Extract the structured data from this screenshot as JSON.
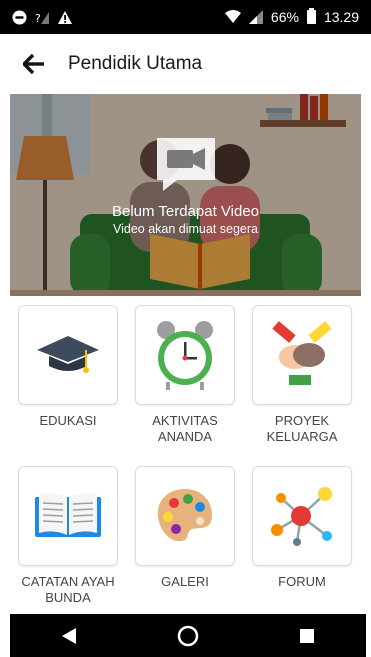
{
  "status_bar": {
    "battery": "66%",
    "time": "13.29",
    "icons": [
      "minus-circle-icon",
      "no-sim-icon",
      "warning-icon",
      "wifi-icon",
      "signal-icon",
      "battery-icon"
    ]
  },
  "header": {
    "back_icon": "arrow-back-icon",
    "title": "Pendidik Utama"
  },
  "hero": {
    "video_title": "Belum Terdapat Video",
    "video_subtitle": "Video akan dimuat segera",
    "icon": "video-camera-icon"
  },
  "menu": {
    "items": [
      {
        "label": "EDUKASI",
        "icon": "graduation-cap-icon"
      },
      {
        "label": "AKTIVITAS ANANDA",
        "icon": "alarm-clock-icon"
      },
      {
        "label": "PROYEK KELUARGA",
        "icon": "handshake-icon"
      },
      {
        "label": "CATATAN AYAH BUNDA",
        "icon": "open-book-icon"
      },
      {
        "label": "GALERI",
        "icon": "palette-icon"
      },
      {
        "label": "FORUM",
        "icon": "network-icon"
      }
    ]
  },
  "nav_bar": {
    "icons": [
      "nav-back-icon",
      "nav-home-icon",
      "nav-recents-icon"
    ]
  }
}
